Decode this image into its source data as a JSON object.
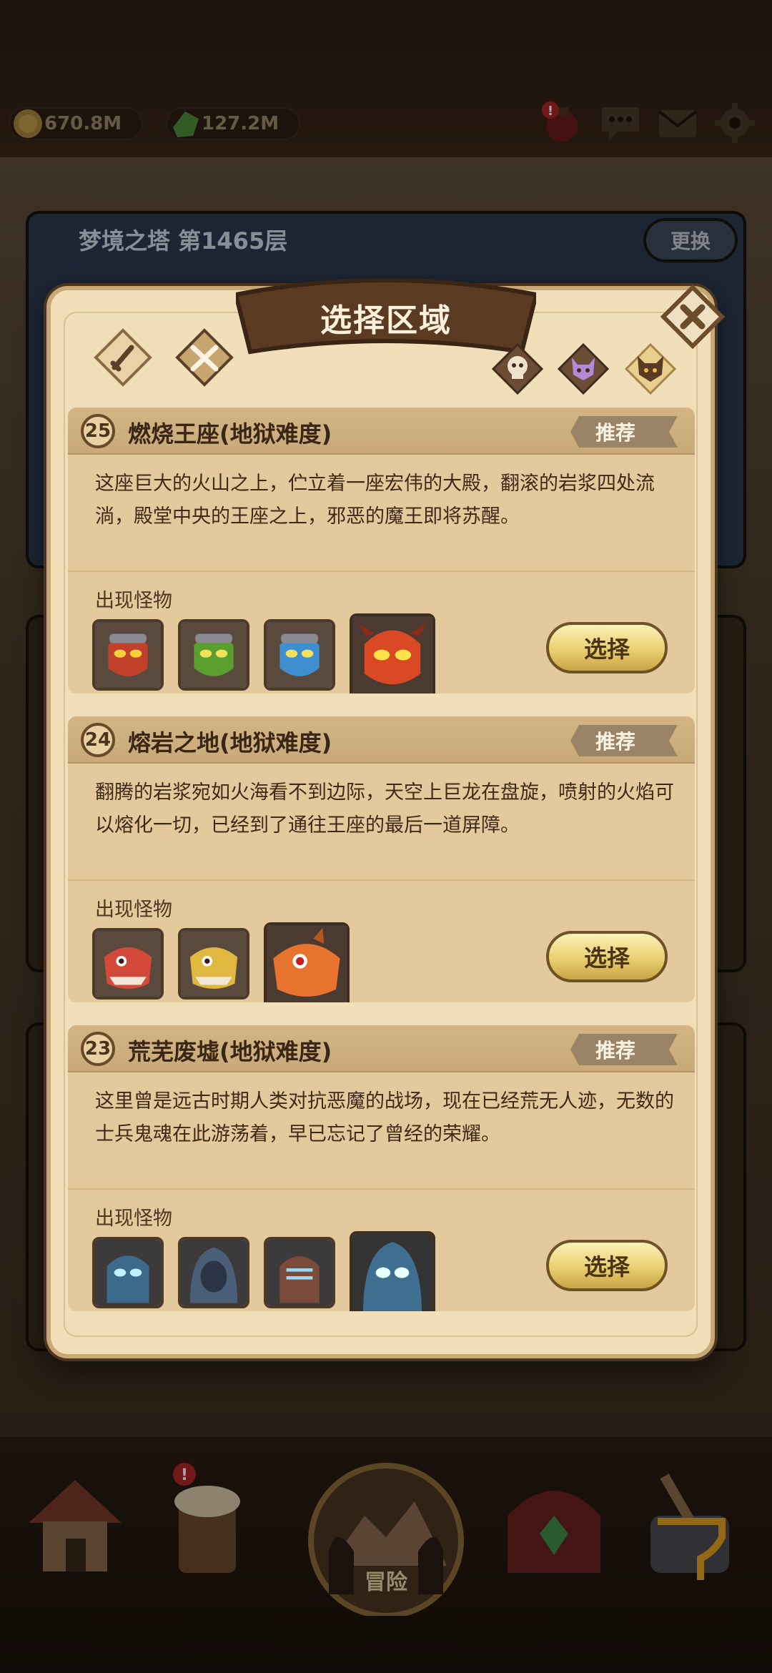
{
  "resources": {
    "gold": "670.8M",
    "gems": "127.2M"
  },
  "background": {
    "tower_title": "梦境之塔 第1465层",
    "change_label": "更换"
  },
  "modal": {
    "title": "选择区域"
  },
  "zones": [
    {
      "level": "25",
      "name": "燃烧王座(地狱难度)",
      "tag": "推荐",
      "description": "这座巨大的火山之上，伫立着一座宏伟的大殿，翻滚的岩浆四处流淌，殿堂中央的王座之上，邪恶的魔王即将苏醒。",
      "monsters_label": "出现怪物",
      "select_label": "选择"
    },
    {
      "level": "24",
      "name": "熔岩之地(地狱难度)",
      "tag": "推荐",
      "description": "翻腾的岩浆宛如火海看不到边际，天空上巨龙在盘旋，喷射的火焰可以熔化一切，已经到了通往王座的最后一道屏障。",
      "monsters_label": "出现怪物",
      "select_label": "选择"
    },
    {
      "level": "23",
      "name": "荒芜废墟(地狱难度)",
      "tag": "推荐",
      "description": "这里曾是远古时期人类对抗恶魔的战场，现在已经荒无人迹，无数的士兵鬼魂在此游荡着，早已忘记了曾经的荣耀。",
      "monsters_label": "出现怪物",
      "select_label": "选择"
    }
  ],
  "nav": {
    "adventure_label": "冒险"
  }
}
